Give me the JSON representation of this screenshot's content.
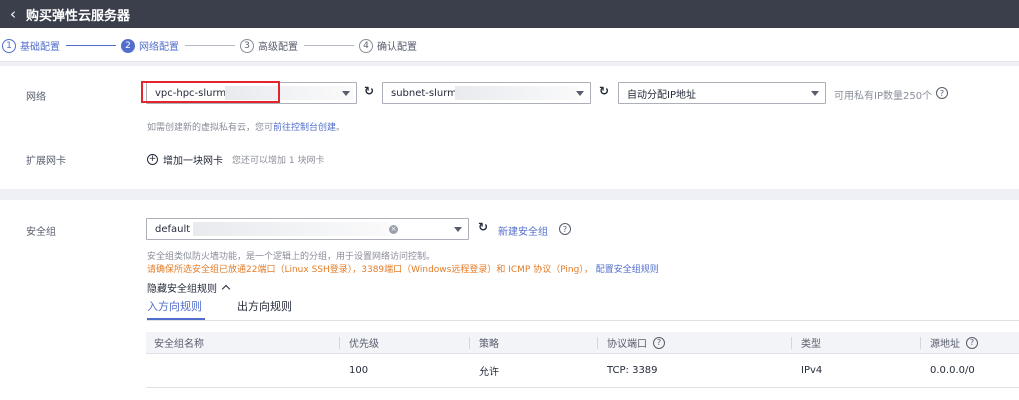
{
  "header": {
    "back_icon": "chevron-left-icon",
    "title": "购买弹性云服务器"
  },
  "steps": [
    {
      "num": "1",
      "label": "基础配置",
      "state": "done"
    },
    {
      "num": "2",
      "label": "网络配置",
      "state": "active"
    },
    {
      "num": "3",
      "label": "高级配置",
      "state": "todo"
    },
    {
      "num": "4",
      "label": "确认配置",
      "state": "todo"
    }
  ],
  "network": {
    "label": "网络",
    "vpc_value": "vpc-hpc-slurm",
    "subnet_value": "subnet-slurm(",
    "ip_mode_value": "自动分配IP地址",
    "ip_available": "可用私有IP数量250个",
    "hint_prefix": "如需创建新的虚拟私有云，您可",
    "hint_link": "前往控制台创建",
    "hint_suffix": "。"
  },
  "nic": {
    "label": "扩展网卡",
    "add_label": "增加一块网卡",
    "hint": "您还可以增加 1 块网卡"
  },
  "security": {
    "label": "安全组",
    "value": "default",
    "new_link": "新建安全组",
    "desc": "安全组类似防火墙功能，是一个逻辑上的分组，用于设置网络访问控制。",
    "warning": "请确保所选安全组已放通22端口（Linux SSH登录），3389端口（Windows远程登录）和 ICMP 协议（Ping），",
    "config_link": "配置安全组规则",
    "toggle_label": "隐藏安全组规则",
    "tabs": [
      "入方向规则",
      "出方向规则"
    ],
    "columns": [
      "安全组名称",
      "优先级",
      "策略",
      "协议端口",
      "类型",
      "源地址"
    ],
    "rows": [
      {
        "name": "",
        "priority": "100",
        "policy": "允许",
        "port": "TCP: 3389",
        "type": "IPv4",
        "source": "0.0.0.0/0"
      }
    ]
  }
}
